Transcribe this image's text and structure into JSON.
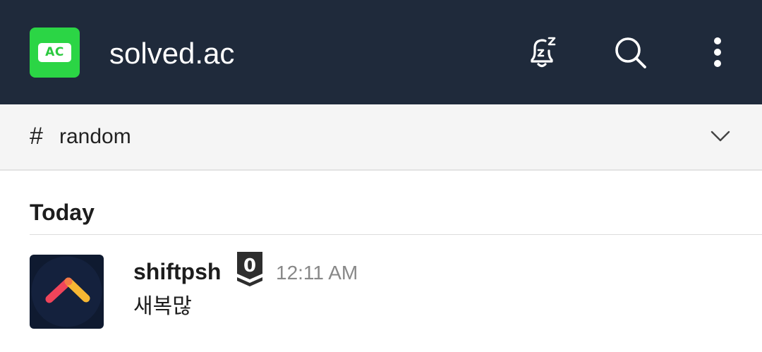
{
  "header": {
    "workspace_logo_text": "AC",
    "workspace_name": "solved.ac",
    "icons": [
      "snooze-bell-icon",
      "search-icon",
      "more-vertical-icon"
    ],
    "background_color": "#1f2a3b",
    "logo_color": "#2bd545"
  },
  "channel": {
    "prefix": "#",
    "name": "random",
    "icon": "chevron-down-icon"
  },
  "feed": {
    "day_label": "Today",
    "messages": [
      {
        "author": "shiftpsh",
        "badge": "0",
        "time": "12:11 AM",
        "text": "새복많",
        "avatar_icon": "chevron-up-logo-icon"
      }
    ]
  }
}
